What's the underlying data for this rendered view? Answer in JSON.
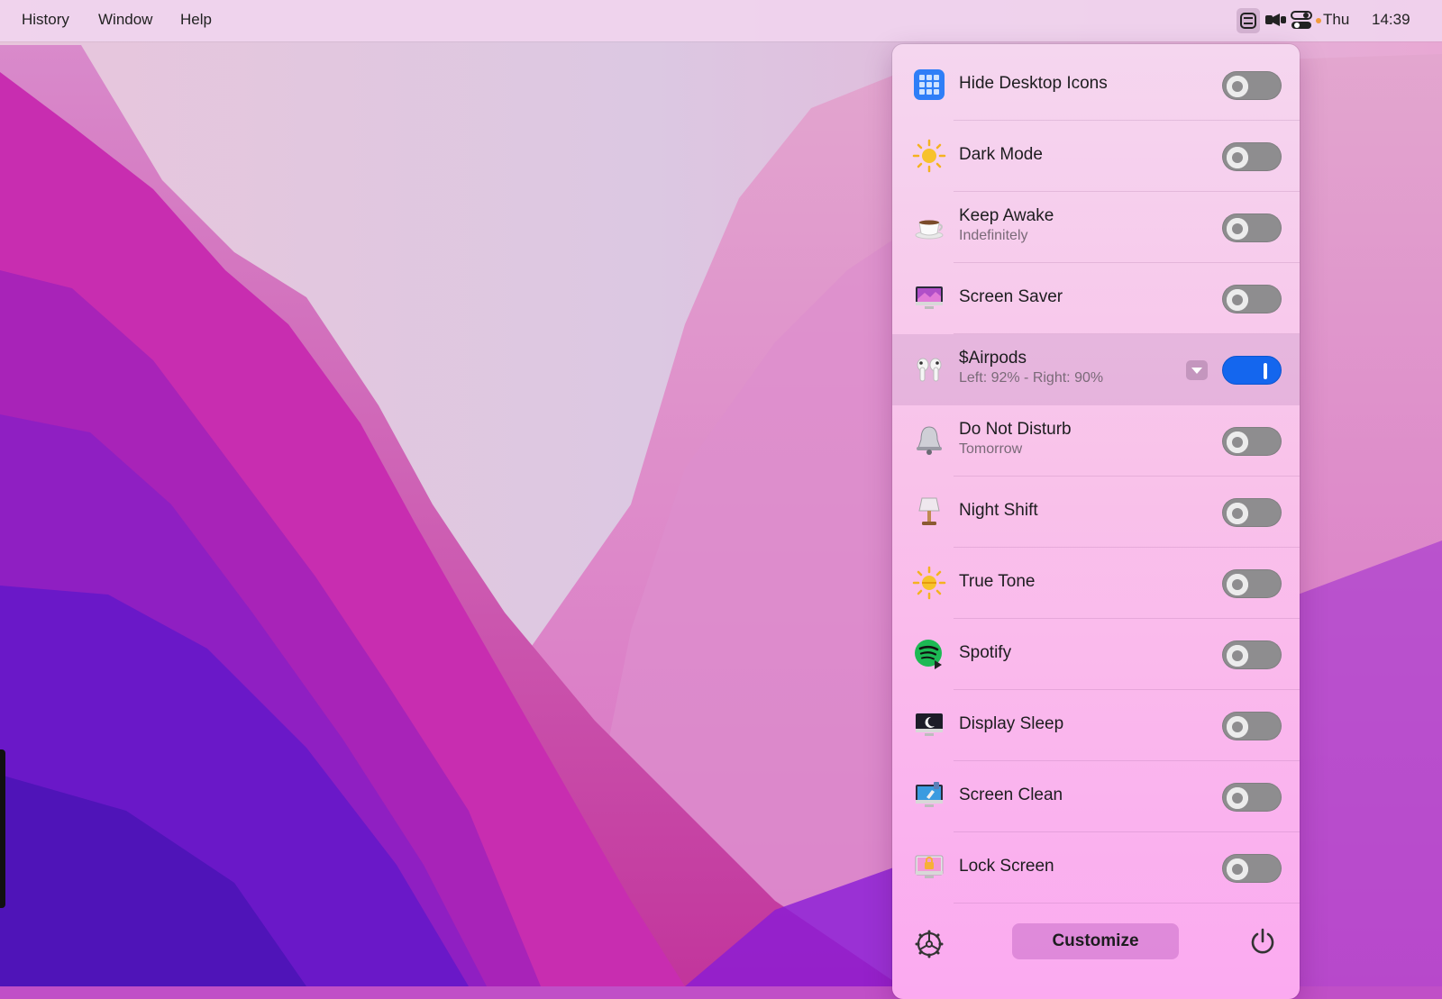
{
  "menubar": {
    "items": [
      "History",
      "Window",
      "Help"
    ],
    "day": "Thu",
    "time": "14:39"
  },
  "panel": {
    "rows": [
      {
        "title": "Hide Desktop Icons",
        "subtitle": "",
        "icon": "grid-icon",
        "on": false
      },
      {
        "title": "Dark Mode",
        "subtitle": "",
        "icon": "sun-icon",
        "on": false
      },
      {
        "title": "Keep Awake",
        "subtitle": "Indefinitely",
        "icon": "coffee-cup-icon",
        "on": false
      },
      {
        "title": "Screen Saver",
        "subtitle": "",
        "icon": "monitor-icon",
        "on": false
      },
      {
        "title": "$Airpods",
        "subtitle": "Left: 92% - Right: 90%",
        "icon": "airpods-icon",
        "on": true
      },
      {
        "title": "Do Not Disturb",
        "subtitle": "Tomorrow",
        "icon": "bell-icon",
        "on": false
      },
      {
        "title": "Night Shift",
        "subtitle": "",
        "icon": "lamp-icon",
        "on": false
      },
      {
        "title": "True Tone",
        "subtitle": "",
        "icon": "sun-half-icon",
        "on": false
      },
      {
        "title": "Spotify",
        "subtitle": "",
        "icon": "spotify-icon",
        "on": false
      },
      {
        "title": "Display Sleep",
        "subtitle": "",
        "icon": "display-moon-icon",
        "on": false
      },
      {
        "title": "Screen Clean",
        "subtitle": "",
        "icon": "screen-clean-icon",
        "on": false
      },
      {
        "title": "Lock Screen",
        "subtitle": "",
        "icon": "lock-screen-icon",
        "on": false
      }
    ],
    "customize_label": "Customize"
  },
  "colors": {
    "toggle_on": "#1466ee",
    "toggle_off": "#8e8d8f"
  }
}
